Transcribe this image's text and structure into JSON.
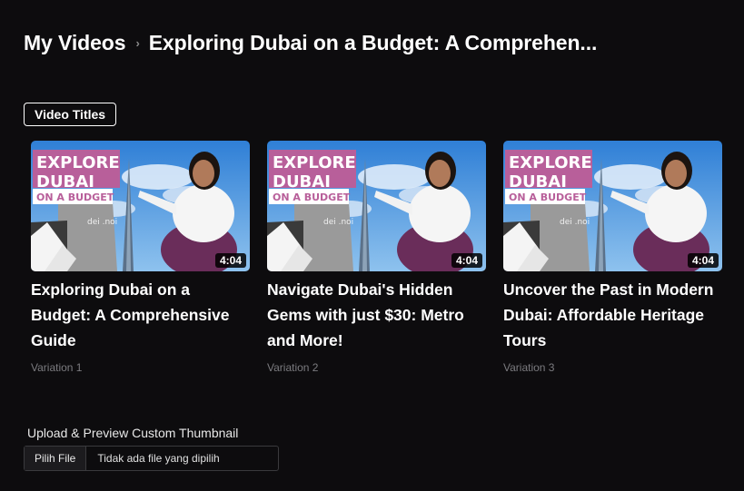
{
  "breadcrumb": {
    "root": "My Videos",
    "separator": "›",
    "current": "Exploring Dubai on a Budget: A Comprehen..."
  },
  "tab": {
    "label": "Video Titles"
  },
  "thumbnail": {
    "text_line1": "EXPLORE",
    "text_line2": "DUBAI",
    "text_line3": "ON A BUDGET",
    "logo_text": "dei\n.noi"
  },
  "cards": [
    {
      "duration": "4:04",
      "title": "Exploring Dubai on a Budget: A Comprehensive Guide",
      "variation": "Variation 1"
    },
    {
      "duration": "4:04",
      "title": "Navigate Dubai's Hidden Gems with just $30: Metro and More!",
      "variation": "Variation 2"
    },
    {
      "duration": "4:04",
      "title": "Uncover the Past in Modern Dubai: Affordable Heritage Tours",
      "variation": "Variation 3"
    }
  ],
  "upload": {
    "label": "Upload & Preview Custom Thumbnail",
    "button_label": "Pilih File",
    "status": "Tidak ada file yang dipilih"
  },
  "colors": {
    "background": "#0d0c0e",
    "thumb_banner": "#b85f9a",
    "thumb_subbanner": "#ffffff",
    "thumb_sky": "#3d8ad8"
  }
}
